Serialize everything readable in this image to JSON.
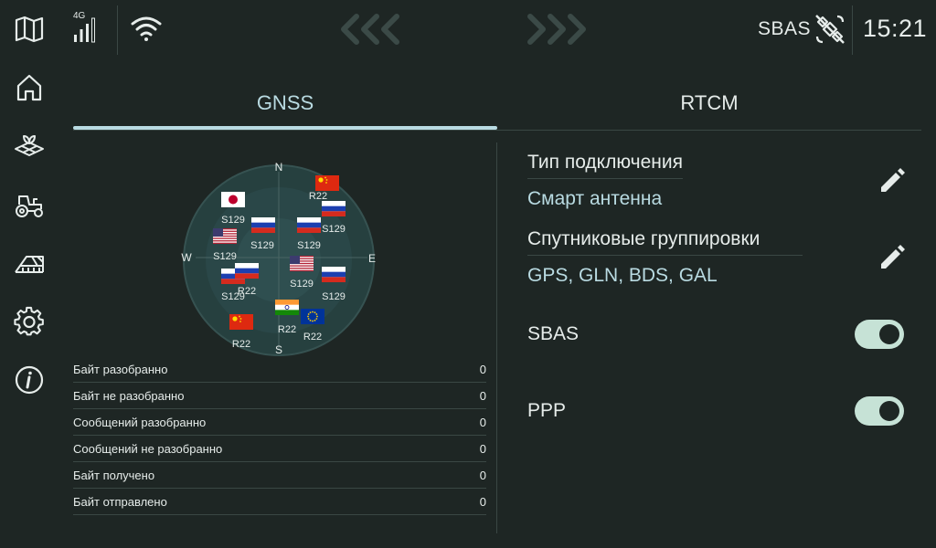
{
  "colors": {
    "background": "#1e2624",
    "accent": "#b9dbe2",
    "text": "#e6ecea",
    "divider": "#3a4744",
    "toggle_on": "#c6e2d6"
  },
  "sidebar": {
    "items": [
      {
        "name": "map-icon"
      },
      {
        "name": "home-icon"
      },
      {
        "name": "field-icon"
      },
      {
        "name": "tractor-icon"
      },
      {
        "name": "implement-icon"
      },
      {
        "name": "gear-icon"
      },
      {
        "name": "info-icon"
      }
    ]
  },
  "topbar": {
    "network_label": "4G",
    "signal_icon": "cellular-signal-icon",
    "wifi_icon": "wifi-icon",
    "nav_left_icon": "triple-chevron-left-icon",
    "nav_right_icon": "triple-chevron-right-icon",
    "sbas_label": "SBAS",
    "sat_icon": "satellite-off-icon",
    "time": "15:21"
  },
  "tabs": [
    {
      "label": "GNSS",
      "active": true
    },
    {
      "label": "RTCM",
      "active": false
    }
  ],
  "skyplot": {
    "directions": {
      "n": "N",
      "e": "E",
      "s": "S",
      "w": "W"
    },
    "satellites": [
      {
        "flag": "cn",
        "label": "R22"
      },
      {
        "flag": "jp",
        "label": "S129"
      },
      {
        "flag": "ru",
        "label": "S129"
      },
      {
        "flag": "ru",
        "label": "S129"
      },
      {
        "flag": "ru",
        "label": "S129"
      },
      {
        "flag": "us",
        "label": "S129"
      },
      {
        "flag": "us",
        "label": "S129"
      },
      {
        "flag": "ru",
        "label": "S129"
      },
      {
        "flag": "ru",
        "label": "S129"
      },
      {
        "flag": "ru",
        "label": "R22"
      },
      {
        "flag": "in",
        "label": "R22"
      },
      {
        "flag": "eu",
        "label": "R22"
      },
      {
        "flag": "cn",
        "label": "R22"
      }
    ]
  },
  "stats": [
    {
      "label": "Байт разобранно",
      "value": "0"
    },
    {
      "label": "Байт не разобранно",
      "value": "0"
    },
    {
      "label": "Сообщений разобранно",
      "value": "0"
    },
    {
      "label": "Сообщений не разобранно",
      "value": "0"
    },
    {
      "label": "Байт получено",
      "value": "0"
    },
    {
      "label": "Байт отправлено",
      "value": "0"
    }
  ],
  "settings": {
    "connection_type": {
      "title": "Тип подключения",
      "value": "Смарт антенна",
      "edit_icon": "pencil-icon"
    },
    "constellations": {
      "title": "Спутниковые группировки",
      "value": "GPS, GLN,  BDS, GAL",
      "edit_icon": "pencil-icon"
    },
    "sbas": {
      "label": "SBAS",
      "enabled": true
    },
    "ppp": {
      "label": "PPP",
      "enabled": true
    }
  }
}
